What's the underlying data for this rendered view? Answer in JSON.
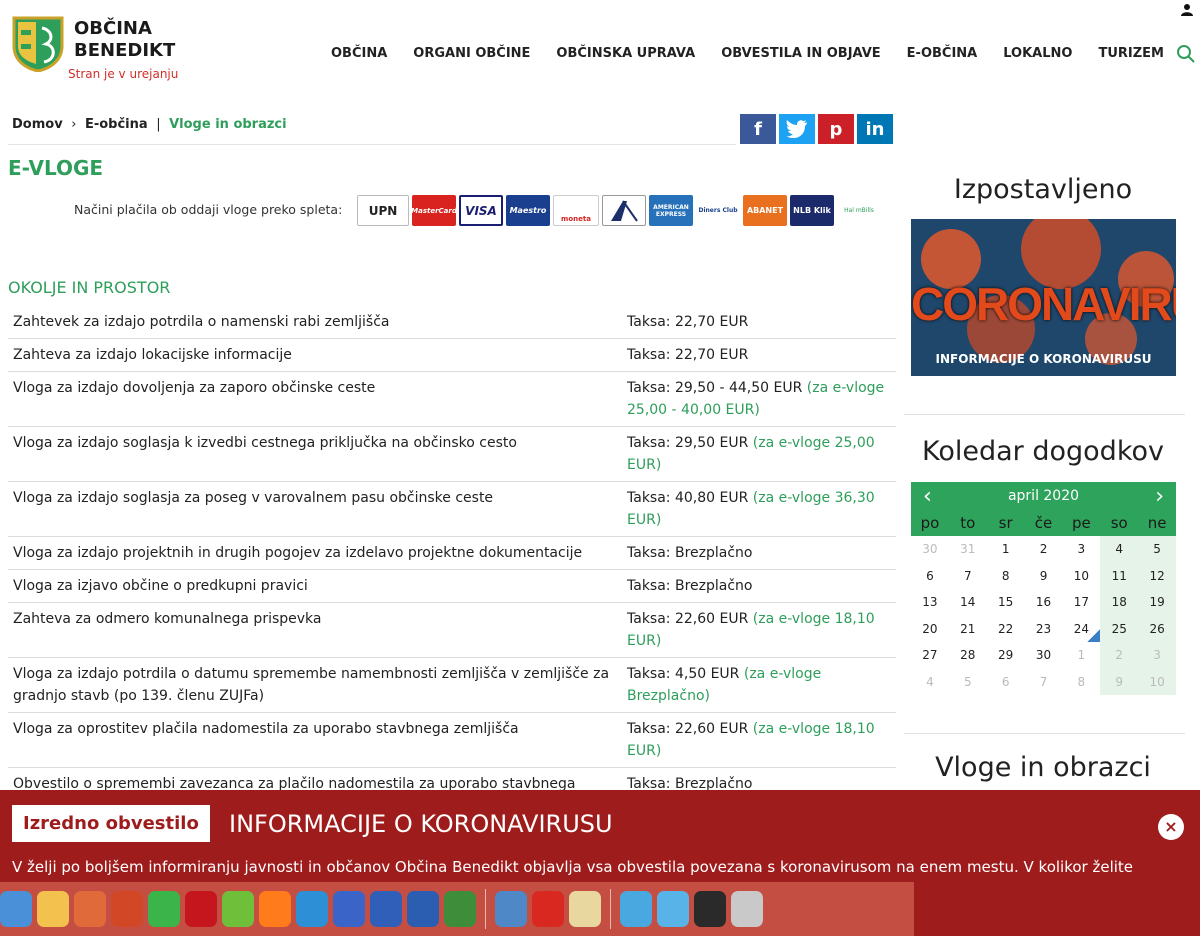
{
  "header": {
    "title_line1": "OBČINA",
    "title_line2": "BENEDIKT",
    "tagline": "Stran je v urejanju",
    "nav": [
      "OBČINA",
      "ORGANI OBČINE",
      "OBČINSKA UPRAVA",
      "OBVESTILA IN OBJAVE",
      "E-OBČINA",
      "LOKALNO",
      "TURIZEM"
    ]
  },
  "breadcrumb": {
    "home": "Domov",
    "sep": "›",
    "section": "E-občina",
    "divider": "|",
    "current": "Vloge in obrazci"
  },
  "social": [
    "f",
    "t",
    "p",
    "in"
  ],
  "main": {
    "title": "E-VLOGE",
    "payment_label": "Načini plačila ob oddaji vloge preko spleta:",
    "payment_methods": [
      "UPN",
      "MasterCard",
      "VISA",
      "Maestro",
      "moneta",
      "",
      "",
      "AMERICAN EXPRESS",
      "Diners Club",
      "ABANET",
      "NLB Klik",
      "Hal mBills"
    ],
    "section_title": "OKOLJE IN PROSTOR",
    "forms": [
      {
        "name": "Zahtevek za izdajo potrdila o namenski rabi zemljišča",
        "fee": "Taksa: 22,70 EUR",
        "fee_e": ""
      },
      {
        "name": "Zahteva za izdajo lokacijske informacije",
        "fee": "Taksa: 22,70 EUR",
        "fee_e": ""
      },
      {
        "name": "Vloga za izdajo dovoljenja za zaporo občinske ceste",
        "fee": "Taksa: 29,50 - 44,50 EUR",
        "fee_e": "(za e-vloge 25,00 - 40,00 EUR)"
      },
      {
        "name": "Vloga za izdajo soglasja k izvedbi cestnega priključka na občinsko cesto",
        "fee": "Taksa: 29,50 EUR",
        "fee_e": "(za e-vloge 25,00 EUR)"
      },
      {
        "name": "Vloga za izdajo soglasja za poseg v varovalnem pasu občinske ceste",
        "fee": "Taksa: 40,80 EUR",
        "fee_e": "(za e-vloge 36,30 EUR)"
      },
      {
        "name": "Vloga za izdajo projektnih in drugih pogojev za izdelavo projektne dokumentacije",
        "fee": "Taksa: Brezplačno",
        "fee_e": ""
      },
      {
        "name": "Vloga za izjavo občine o predkupni pravici",
        "fee": "Taksa: Brezplačno",
        "fee_e": ""
      },
      {
        "name": "Zahteva za odmero komunalnega prispevka",
        "fee": "Taksa: 22,60 EUR",
        "fee_e": "(za e-vloge 18,10 EUR)"
      },
      {
        "name": "Vloga za izdajo potrdila o datumu spremembe namembnosti zemljišča v zemljišče za gradnjo stavb (po 139. členu ZUJFa)",
        "fee": "Taksa: 4,50 EUR",
        "fee_e": "(za e-vloge Brezplačno)"
      },
      {
        "name": "Vloga za oprostitev plačila nadomestila za uporabo stavbnega zemljišča",
        "fee": "Taksa: 22,60 EUR",
        "fee_e": "(za e-vloge 18,10 EUR)"
      },
      {
        "name": "Obvestilo o spremembi zavezanca za plačilo nadomestila za uporabo stavbnega",
        "fee": "Taksa: Brezplačno",
        "fee_e": ""
      }
    ]
  },
  "sidebar": {
    "featured_title": "Izpostavljeno",
    "banner_big": "CORONAVIRUS",
    "banner_caption": "INFORMACIJE O KORONAVIRUSU",
    "calendar_title": "Koledar dogodkov",
    "calendar": {
      "month": "april 2020",
      "prev": "‹",
      "next": "›",
      "days": [
        "po",
        "to",
        "sr",
        "če",
        "pe",
        "so",
        "ne"
      ],
      "weeks": [
        [
          "30",
          "31",
          "1",
          "2",
          "3",
          "4",
          "5"
        ],
        [
          "6",
          "7",
          "8",
          "9",
          "10",
          "11",
          "12"
        ],
        [
          "13",
          "14",
          "15",
          "16",
          "17",
          "18",
          "19"
        ],
        [
          "20",
          "21",
          "22",
          "23",
          "24",
          "25",
          "26"
        ],
        [
          "27",
          "28",
          "29",
          "30",
          "1",
          "2",
          "3"
        ],
        [
          "4",
          "5",
          "6",
          "7",
          "8",
          "9",
          "10"
        ]
      ]
    },
    "forms_title": "Vloge in obrazci"
  },
  "notice": {
    "badge": "Izredno obvestilo",
    "title": "INFORMACIJE O KORONAVIRUSU",
    "close": "×",
    "text": "V želji po boljšem informiranju javnosti in občanov Občina Benedikt objavlja vsa obvestila povezana s koronavirusom na enem mestu. V kolikor želite"
  },
  "colors": {
    "accent": "#2e9e5b",
    "notice": "#9e1c1c",
    "facebook": "#3b5998",
    "twitter": "#1da1f2",
    "pinterest": "#cb2027",
    "linkedin": "#0077b5"
  },
  "dock_icons": [
    "finder-icon",
    "textedit-icon",
    "remote-desktop-icon",
    "powerpoint-icon",
    "facetime-icon",
    "acrobat-icon",
    "calculator-plus-icon",
    "firefox-icon",
    "network-icon",
    "vnc-icon",
    "screen-share-icon",
    "add-screen-icon",
    "keynote-icon",
    "preview-icon",
    "pdf-icon",
    "script-editor-icon",
    "downloads-folder-icon",
    "folder-icon",
    "movie-icon",
    "trash-icon"
  ]
}
